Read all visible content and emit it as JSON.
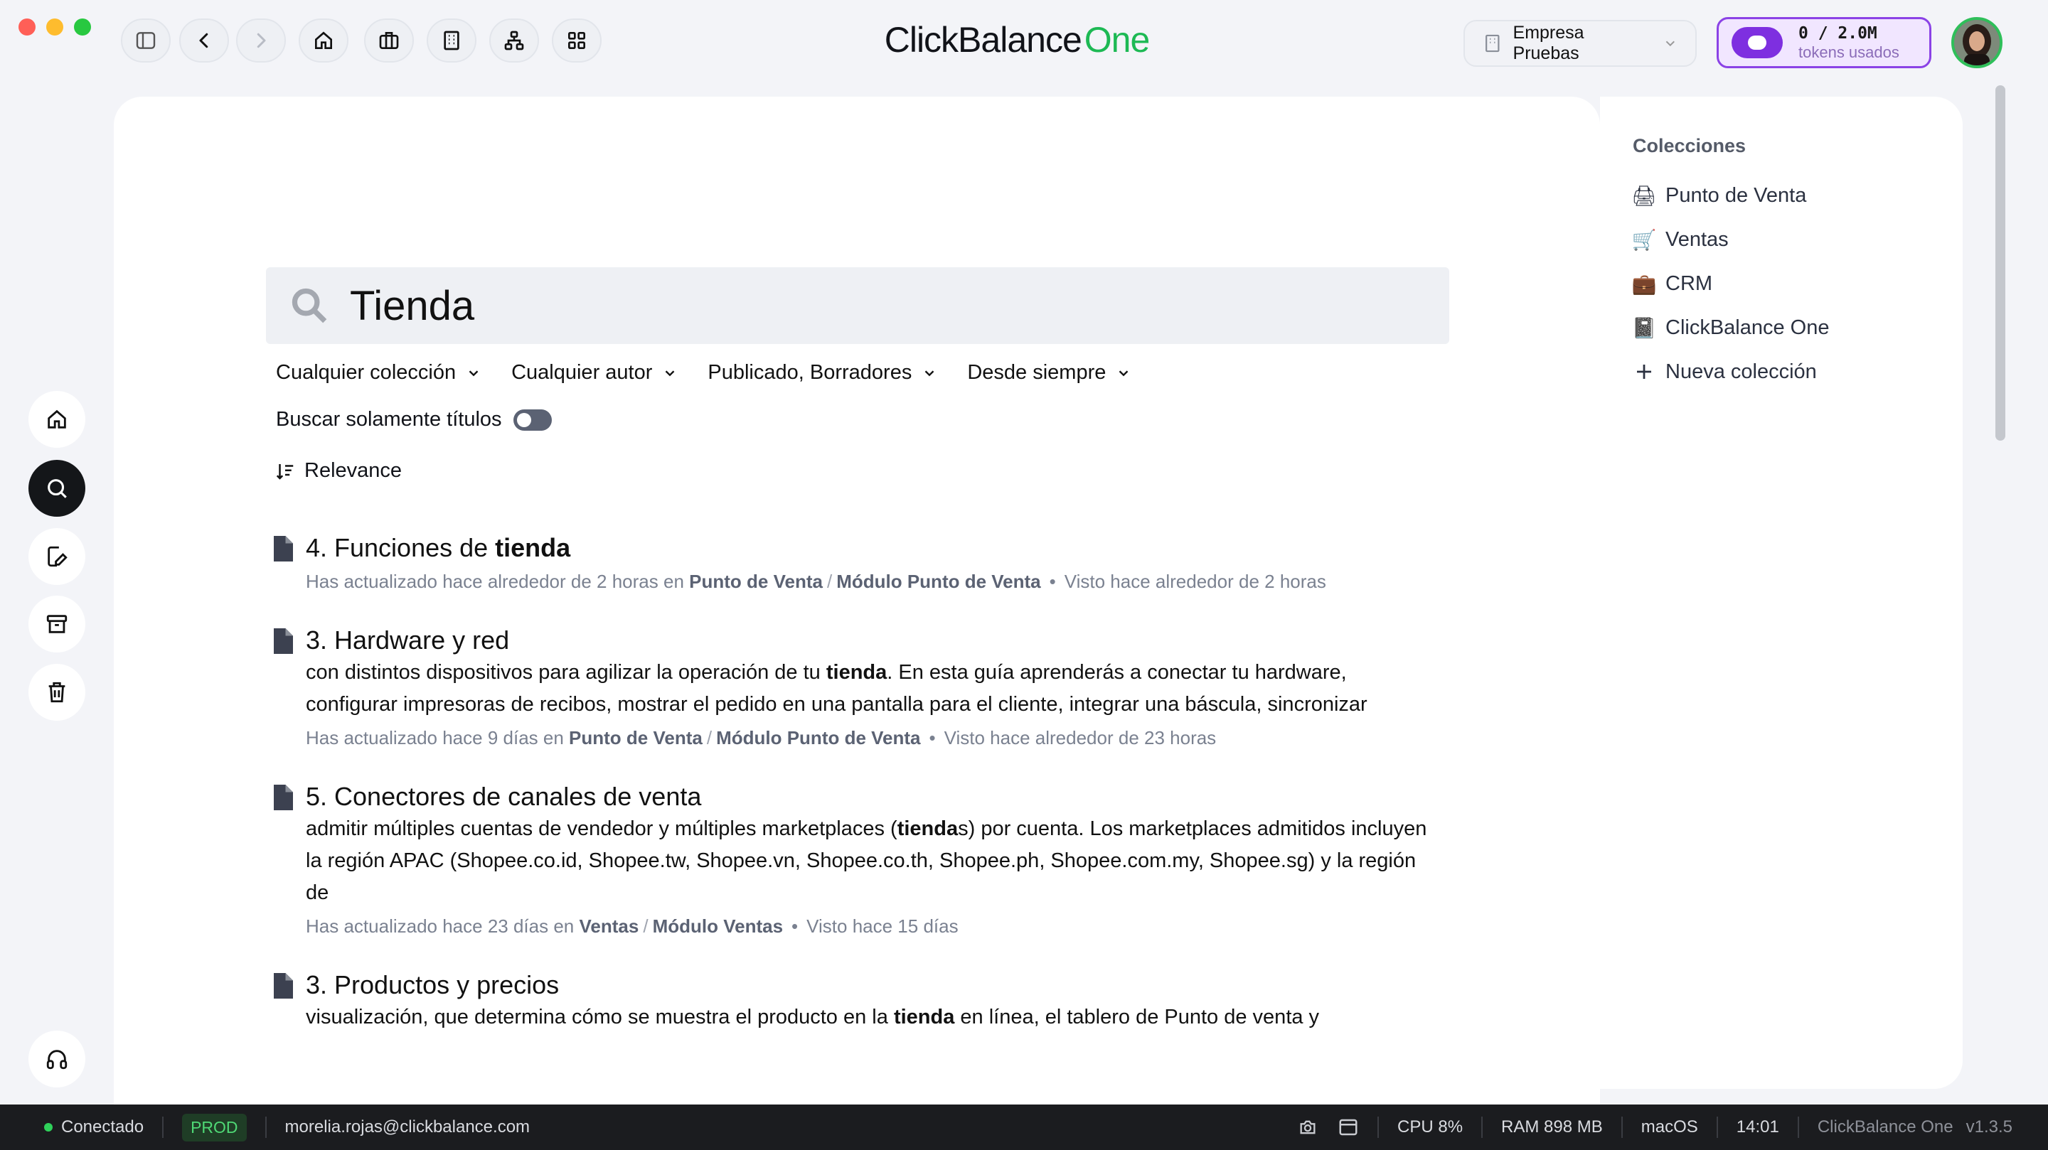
{
  "app": {
    "brand_part1": "ClickBalance",
    "brand_part2": "One",
    "company": "Empresa Pruebas",
    "tokens": "0 / 2.0M",
    "tokens_label": "tokens usados",
    "colors": {
      "brand_green": "#1db954",
      "token_purple": "#7e2fe0",
      "active_rail": "#141619"
    }
  },
  "toolbar": {
    "icons": [
      "sidebar-toggle-icon",
      "back-icon",
      "forward-icon",
      "home-icon",
      "briefcase-icon",
      "building-icon",
      "org-chart-icon",
      "apps-grid-icon"
    ]
  },
  "search": {
    "query": "Tienda",
    "filters": [
      "Cualquier colección",
      "Cualquier autor",
      "Publicado, Borradores",
      "Desde siempre"
    ],
    "titles_only_label": "Buscar solamente títulos",
    "titles_only_enabled": false,
    "sort_label": "Relevance"
  },
  "results": [
    {
      "title": "4. Funciones de tienda",
      "title_pre": "4. Funciones de ",
      "title_bold": "tienda",
      "snippet_parts": [],
      "meta_prefix": "Has actualizado hace alrededor de 2 horas en",
      "collection": "Punto de Venta",
      "document": "Módulo Punto de Venta",
      "viewed": "Visto hace alrededor de 2 horas"
    },
    {
      "title": "3. Hardware y red",
      "snippet_a": "con distintos dispositivos para agilizar la operación de tu ",
      "snippet_b": "tienda",
      "snippet_c": ". En esta guía aprenderás a conectar tu hardware, configurar impresoras de recibos, mostrar el pedido en una pantalla para el cliente, integrar una báscula, sincronizar",
      "meta_prefix": "Has actualizado hace 9 días en",
      "collection": "Punto de Venta",
      "document": "Módulo Punto de Venta",
      "viewed": "Visto hace alrededor de 23 horas"
    },
    {
      "title": "5. Conectores de canales de venta",
      "snippet_a": "admitir múltiples cuentas de vendedor y múltiples marketplaces (",
      "snippet_b": "tienda",
      "snippet_c": "s) por cuenta. Los marketplaces admitidos incluyen la región APAC (Shopee.co.id, Shopee.tw, Shopee.vn, Shopee.co.th, Shopee.ph, Shopee.com.my, Shopee.sg) y la región de",
      "meta_prefix": "Has actualizado hace 23 días en",
      "collection": "Ventas",
      "document": "Módulo Ventas",
      "viewed": "Visto hace 15 días"
    },
    {
      "title": "3. Productos y precios",
      "snippet_a": "visualización, que determina cómo se muestra el producto en la ",
      "snippet_b": "tienda",
      "snippet_c": " en línea, el tablero de Punto de venta y"
    }
  ],
  "collections": {
    "heading": "Colecciones",
    "items": [
      {
        "label": "Punto de Venta",
        "icon": "cash-register-icon",
        "emoji": "🖨"
      },
      {
        "label": "Ventas",
        "icon": "cart-icon",
        "emoji": "🛒"
      },
      {
        "label": "CRM",
        "icon": "briefcase-icon",
        "emoji": "💼"
      },
      {
        "label": "ClickBalance One",
        "icon": "notebook-icon",
        "emoji": "📓"
      }
    ],
    "new_label": "Nueva colección"
  },
  "statusbar": {
    "connection": "Conectado",
    "env": "PROD",
    "email": "morelia.rojas@clickbalance.com",
    "cpu": "CPU 8%",
    "ram": "RAM 898 MB",
    "os": "macOS",
    "time": "14:01",
    "app_name": "ClickBalance One",
    "version": "v1.3.5"
  }
}
